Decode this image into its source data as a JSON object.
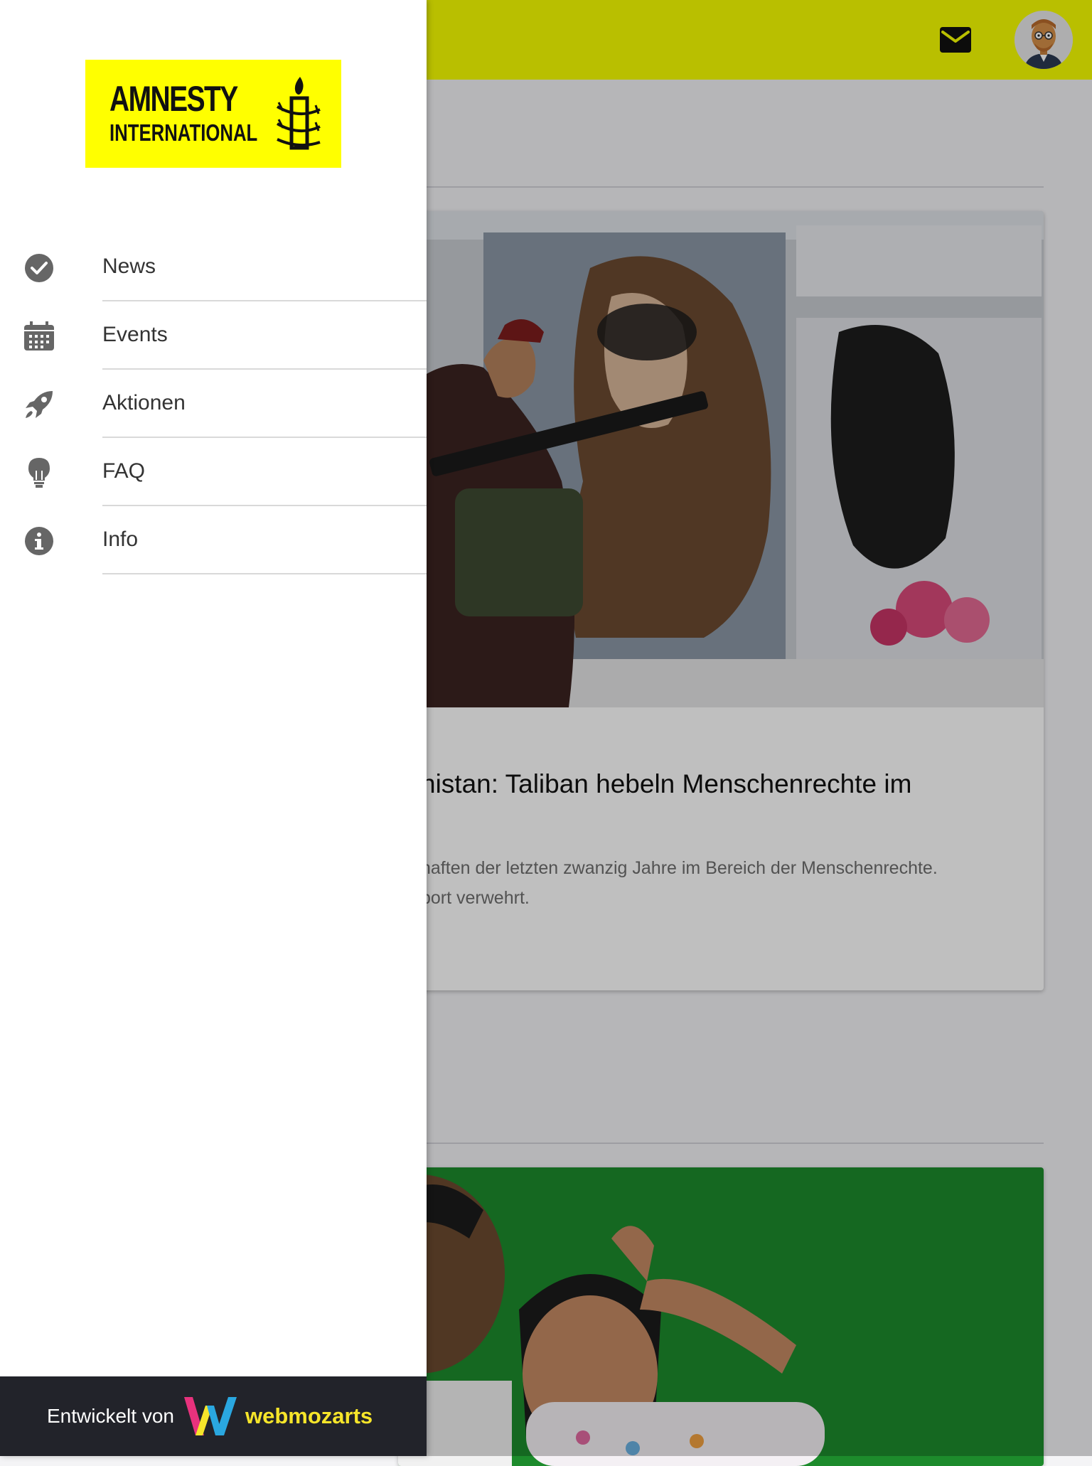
{
  "drawer": {
    "logo": {
      "line1": "AMNESTY",
      "line2": "INTERNATIONAL",
      "background": "#ffff00"
    },
    "items": [
      {
        "label": "News",
        "icon": "check-circle-icon"
      },
      {
        "label": "Events",
        "icon": "calendar-icon"
      },
      {
        "label": "Aktionen",
        "icon": "rocket-icon"
      },
      {
        "label": "FAQ",
        "icon": "lightbulb-icon"
      },
      {
        "label": "Info",
        "icon": "info-icon"
      }
    ],
    "footer": {
      "text": "Entwickelt von",
      "brand": "webmozarts",
      "brand_color": "#f6e52a"
    }
  },
  "header": {
    "color": "#f7ff00",
    "mail_icon": "mail-icon",
    "avatar": "avatar"
  },
  "main": {
    "card1": {
      "title": "nistan: Taliban hebeln Menschenrechte im",
      "excerpt_lines": [
        "haften der letzten zwanzig Jahre im Bereich der Menschenrechte.",
        "port verwehrt."
      ]
    }
  }
}
